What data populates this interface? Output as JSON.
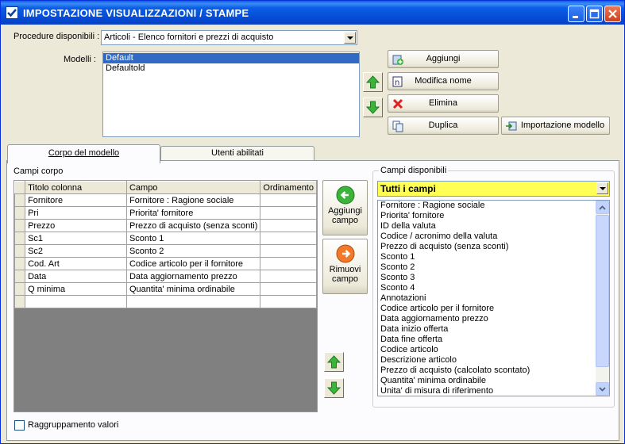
{
  "window": {
    "title": "IMPOSTAZIONE VISUALIZZAZIONI / STAMPE"
  },
  "procedure": {
    "label": "Procedure disponibili :",
    "selected": "Articoli - Elenco fornitori e prezzi di acquisto"
  },
  "modelli": {
    "label": "Modelli :",
    "items": [
      "Default",
      "Defaultold"
    ],
    "selected_index": 0
  },
  "model_buttons": {
    "aggiungi": "Aggiungi",
    "modifica_nome": "Modifica nome",
    "elimina": "Elimina",
    "duplica": "Duplica",
    "importazione": "Importazione modello"
  },
  "tabs": [
    {
      "label": "Corpo del modello",
      "active": true
    },
    {
      "label": "Utenti abilitati",
      "active": false
    }
  ],
  "campi_corpo": {
    "label": "Campi corpo",
    "columns": [
      "Titolo colonna",
      "Campo",
      "Ordinamento"
    ],
    "rows": [
      [
        "Fornitore",
        "Fornitore : Ragione sociale",
        ""
      ],
      [
        "Pri",
        "Priorita' fornitore",
        ""
      ],
      [
        "Prezzo",
        "Prezzo di acquisto (senza sconti)",
        ""
      ],
      [
        "Sc1",
        "Sconto 1",
        ""
      ],
      [
        "Sc2",
        "Sconto 2",
        ""
      ],
      [
        "Cod. Art",
        "Codice articolo per il fornitore",
        ""
      ],
      [
        "Data",
        "Data aggiornamento prezzo",
        ""
      ],
      [
        "Q minima",
        "Quantita' minima ordinabile",
        ""
      ],
      [
        "",
        "",
        ""
      ]
    ]
  },
  "field_buttons": {
    "aggiungi_line1": "Aggiungi",
    "aggiungi_line2": "campo",
    "rimuovi_line1": "Rimuovi",
    "rimuovi_line2": "campo"
  },
  "campi_disponibili": {
    "label": "Campi disponibili",
    "filter": "Tutti i campi",
    "items": [
      "Fornitore : Ragione sociale",
      "Priorita' fornitore",
      "ID della valuta",
      "Codice / acronimo della valuta",
      "Prezzo di acquisto (senza sconti)",
      "Sconto 1",
      "Sconto 2",
      "Sconto 3",
      "Sconto 4",
      "Annotazioni",
      "Codice articolo per il fornitore",
      "Data aggiornamento prezzo",
      "Data inizio offerta",
      "Data fine offerta",
      "Codice articolo",
      "Descrizione articolo",
      "Prezzo di acquisto (calcolato scontato)",
      "Quantita' minima ordinabile",
      "Unita' di misura di riferimento"
    ]
  },
  "raggruppamento": {
    "label": "Raggruppamento valori",
    "checked": false
  },
  "colors": {
    "title_bar": "#0a5ee6",
    "selection": "#316ac5",
    "filter_highlight": "#ffff55",
    "arrow_green": "#3cb43c"
  }
}
